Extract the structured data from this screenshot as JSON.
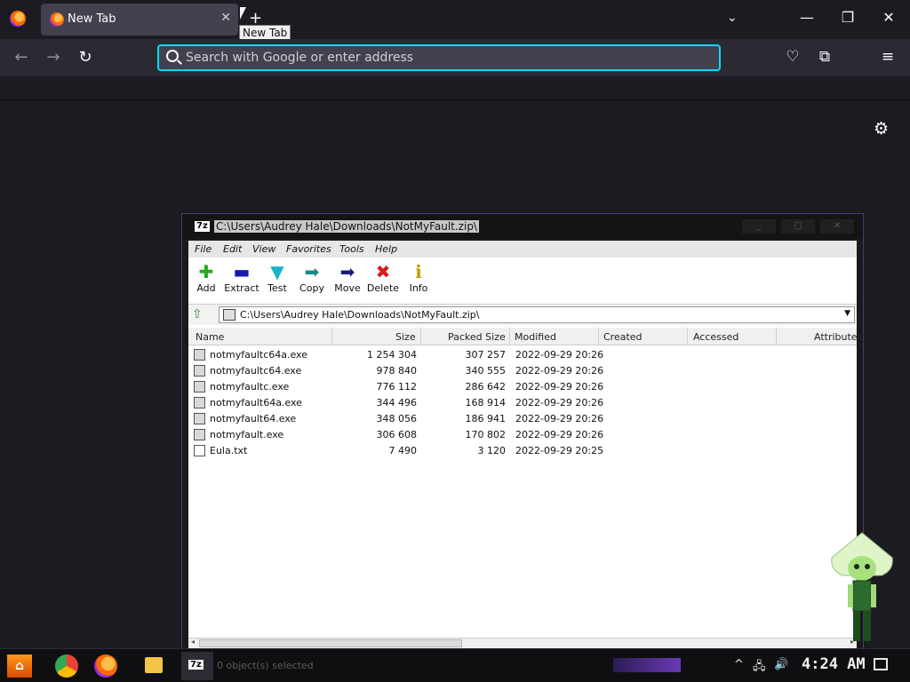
{
  "browser": {
    "tab_title": "New Tab",
    "tab_close": "✕",
    "new_tab_symbol": "+",
    "tooltip": "New Tab",
    "tab_list_symbol": "⌄",
    "minimize": "—",
    "restore": "❐",
    "close": "✕",
    "back": "←",
    "forward": "→",
    "reload": "↻",
    "url_placeholder": "Search with Google or enter address",
    "pocket": "♡",
    "extensions": "⧉",
    "menu": "≡",
    "settings": "⚙"
  },
  "zip": {
    "title": "C:\\Users\\Audrey Hale\\Downloads\\NotMyFault.zip\\",
    "logo": "7z",
    "menu": [
      "File",
      "Edit",
      "View",
      "Favorites",
      "Tools",
      "Help"
    ],
    "tools": [
      {
        "label": "Add",
        "icon": "plus-icon",
        "glyph": "✚",
        "color": "#22aa22"
      },
      {
        "label": "Extract",
        "icon": "minus-icon",
        "glyph": "▬",
        "color": "#1a1aa8"
      },
      {
        "label": "Test",
        "icon": "check-icon",
        "glyph": "▼",
        "color": "#19b3c8"
      },
      {
        "label": "Copy",
        "icon": "copy-arrow-icon",
        "glyph": "➡",
        "color": "#1a8a8a"
      },
      {
        "label": "Move",
        "icon": "move-arrow-icon",
        "glyph": "➡",
        "color": "#1a1a7a"
      },
      {
        "label": "Delete",
        "icon": "delete-x-icon",
        "glyph": "✖",
        "color": "#d81b1b"
      },
      {
        "label": "Info",
        "icon": "info-icon",
        "glyph": "ℹ",
        "color": "#c49a00"
      }
    ],
    "up_symbol": "⇧",
    "path": "C:\\Users\\Audrey Hale\\Downloads\\NotMyFault.zip\\",
    "dropdown": "▼",
    "columns": [
      "Name",
      "Size",
      "Packed Size",
      "Modified",
      "Created",
      "Accessed",
      "Attributes"
    ],
    "files": [
      {
        "name": "notmyfaultc64a.exe",
        "size": "1 254 304",
        "packed": "307 257",
        "modified": "2022-09-29 20:26",
        "type": "exe"
      },
      {
        "name": "notmyfaultc64.exe",
        "size": "978 840",
        "packed": "340 555",
        "modified": "2022-09-29 20:26",
        "type": "exe"
      },
      {
        "name": "notmyfaultc.exe",
        "size": "776 112",
        "packed": "286 642",
        "modified": "2022-09-29 20:26",
        "type": "exe"
      },
      {
        "name": "notmyfault64a.exe",
        "size": "344 496",
        "packed": "168 914",
        "modified": "2022-09-29 20:26",
        "type": "exe"
      },
      {
        "name": "notmyfault64.exe",
        "size": "348 056",
        "packed": "186 941",
        "modified": "2022-09-29 20:26",
        "type": "exe"
      },
      {
        "name": "notmyfault.exe",
        "size": "306 608",
        "packed": "170 802",
        "modified": "2022-09-29 20:26",
        "type": "exe"
      },
      {
        "name": "Eula.txt",
        "size": "7 490",
        "packed": "3 120",
        "modified": "2022-09-29 20:25",
        "type": "txt"
      }
    ],
    "status": "0 object(s) selected",
    "scroll_left": "◂",
    "scroll_right": "▸"
  },
  "taskbar": {
    "start_label": "⌂",
    "seven_zip_label": "7z",
    "chevron": "^",
    "network": "🖧",
    "volume": "🔊",
    "clock": "4:24 AM"
  }
}
